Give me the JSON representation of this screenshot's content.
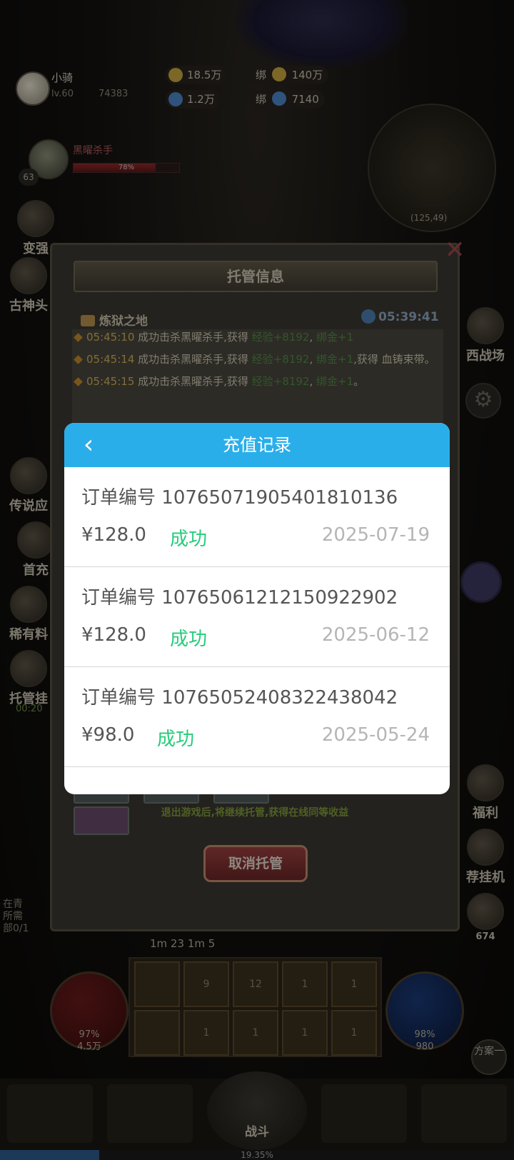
{
  "hud": {
    "player_name": "小骑",
    "player_level": "lv.60",
    "player_power": "74383",
    "gold": "18.5万",
    "gem": "1.2万",
    "bound_gold_label": "绑",
    "bound_gold": "140万",
    "bound_gem_label": "绑",
    "bound_gem": "7140",
    "boss_name": "黑曜杀手",
    "boss_level": "63",
    "boss_hp_percent": 78,
    "boss_hp_text": "78%",
    "minimap_coord": "(125,49)"
  },
  "side_left": [
    "变强",
    "古神头",
    "传说应",
    "首充",
    "稀有料",
    "托管挂"
  ],
  "side_left_timer": "00:20",
  "side_right": [
    "西战场",
    "福利",
    "荐挂机",
    "674"
  ],
  "panel": {
    "title": "托管信息",
    "map_name": "炼狱之地",
    "clock": "05:39:41",
    "log": [
      {
        "time": "05:45:10",
        "text": "成功击杀黑曜杀手,获得",
        "exp": "经验+8192",
        "gold": "绑金+1",
        "extra": ""
      },
      {
        "time": "05:45:14",
        "text": "成功击杀黑曜杀手,获得",
        "exp": "经验+8192",
        "gold": "绑金+1",
        "extra": ",获得 血铸束带。"
      },
      {
        "time": "05:45:15",
        "text": "成功击杀黑曜杀手,获得",
        "exp": "经验+8192",
        "gold": "绑金+1",
        "extra": "。"
      }
    ],
    "note": "退出游戏后,将继续托管,获得在线同等收益",
    "cancel_label": "取消托管"
  },
  "hint_left": [
    "在青",
    "所需",
    "部0/1"
  ],
  "bottom_cd": "1m 23 1m 5",
  "skills": [
    "",
    "9",
    "12",
    "1",
    "1",
    "",
    "1",
    "1",
    "1",
    "1"
  ],
  "hp_orb": {
    "percent": "97%",
    "value": "4.5万"
  },
  "mp_orb": {
    "percent": "98%",
    "value": "980"
  },
  "plan_label": "方案一",
  "fight_label": "战斗",
  "exp_percent": 19.35,
  "exp_text": "19.35%",
  "dialog": {
    "title": "充值记录",
    "back_icon": "chevron-left-icon",
    "order_label": "订单编号",
    "orders": [
      {
        "id": "10765071905401810136",
        "amount": "¥128.0",
        "status": "成功",
        "date": "2025-07-19"
      },
      {
        "id": "10765061212150922902",
        "amount": "¥128.0",
        "status": "成功",
        "date": "2025-06-12"
      },
      {
        "id": "10765052408322438042",
        "amount": "¥98.0",
        "status": "成功",
        "date": "2025-05-24"
      }
    ]
  },
  "colors": {
    "dialog_header": "#2aaeea",
    "status_success": "#26cc7a",
    "date_text": "#b5b5b5"
  }
}
